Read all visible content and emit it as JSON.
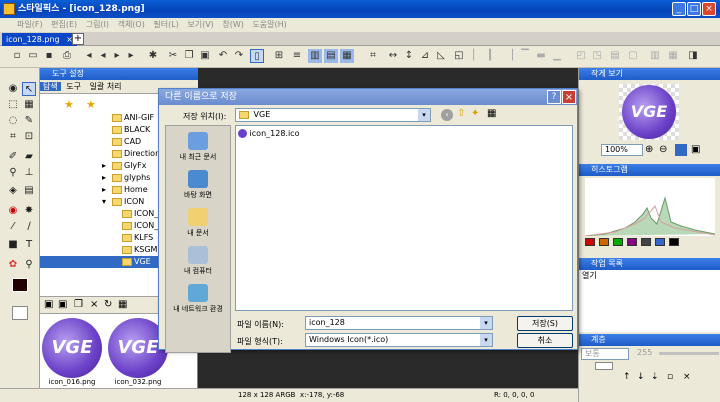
{
  "app": {
    "title": "스타일픽스 - [icon_128.png]",
    "menu": [
      "파일(F)",
      "편집(E)",
      "그림(I)",
      "객체(O)",
      "필터(L)",
      "보기(V)",
      "창(W)",
      "도움말(H)"
    ],
    "doc_tab": "icon_128.png"
  },
  "left": {
    "panel_title": "도구 설정",
    "subtabs": [
      "탐색",
      "도구",
      "일괄 처리"
    ],
    "tree": [
      {
        "label": "ANI-GIF",
        "expander": ""
      },
      {
        "label": "BLACK",
        "expander": ""
      },
      {
        "label": "CAD",
        "expander": ""
      },
      {
        "label": "Direction",
        "expander": ""
      },
      {
        "label": "GlyFx",
        "expander": "▸"
      },
      {
        "label": "glyphs",
        "expander": "▸"
      },
      {
        "label": "Home",
        "expander": "▸"
      },
      {
        "label": "ICON",
        "expander": "▾"
      },
      {
        "label": "ICON_",
        "expander": ""
      },
      {
        "label": "ICON_",
        "expander": ""
      },
      {
        "label": "KLFS",
        "expander": ""
      },
      {
        "label": "KSGM",
        "expander": ""
      },
      {
        "label": "VGE",
        "expander": "",
        "selected": true
      }
    ],
    "thumbs": [
      {
        "label": "icon_016.png",
        "text": "VGE"
      },
      {
        "label": "icon_032.png",
        "text": "VGE"
      }
    ]
  },
  "right": {
    "panel_work": "작게 보기",
    "zoom": "100%",
    "histogram": "히스토그램",
    "tasks": "작업 목록",
    "task_item": "열기",
    "layers": "계층",
    "layer_mode": "보통",
    "layer_opacity": "255"
  },
  "status": {
    "size": "128 x 128 ARGB",
    "coord": "x:-178, y:-68",
    "rgba": "R: 0, 0, 0, 0"
  },
  "dialog": {
    "title": "다른 이름으로 저장",
    "location_label": "저장 위치(I):",
    "location_value": "VGE",
    "places": [
      "내 최근 문서",
      "바탕 화면",
      "내 문서",
      "내 컴퓨터",
      "내 네트워크 환경"
    ],
    "files": [
      {
        "name": "icon_128.ico"
      }
    ],
    "filename_label": "파일 이름(N):",
    "filename_value": "icon_128",
    "filetype_label": "파일 형식(T):",
    "filetype_value": "Windows Icon(*.ico)",
    "save_button": "저장(S)",
    "cancel_button": "취소"
  },
  "colors": {
    "titlebar": "#0a46c8",
    "selection": "#316ac5",
    "accent": "#6a40c8"
  }
}
